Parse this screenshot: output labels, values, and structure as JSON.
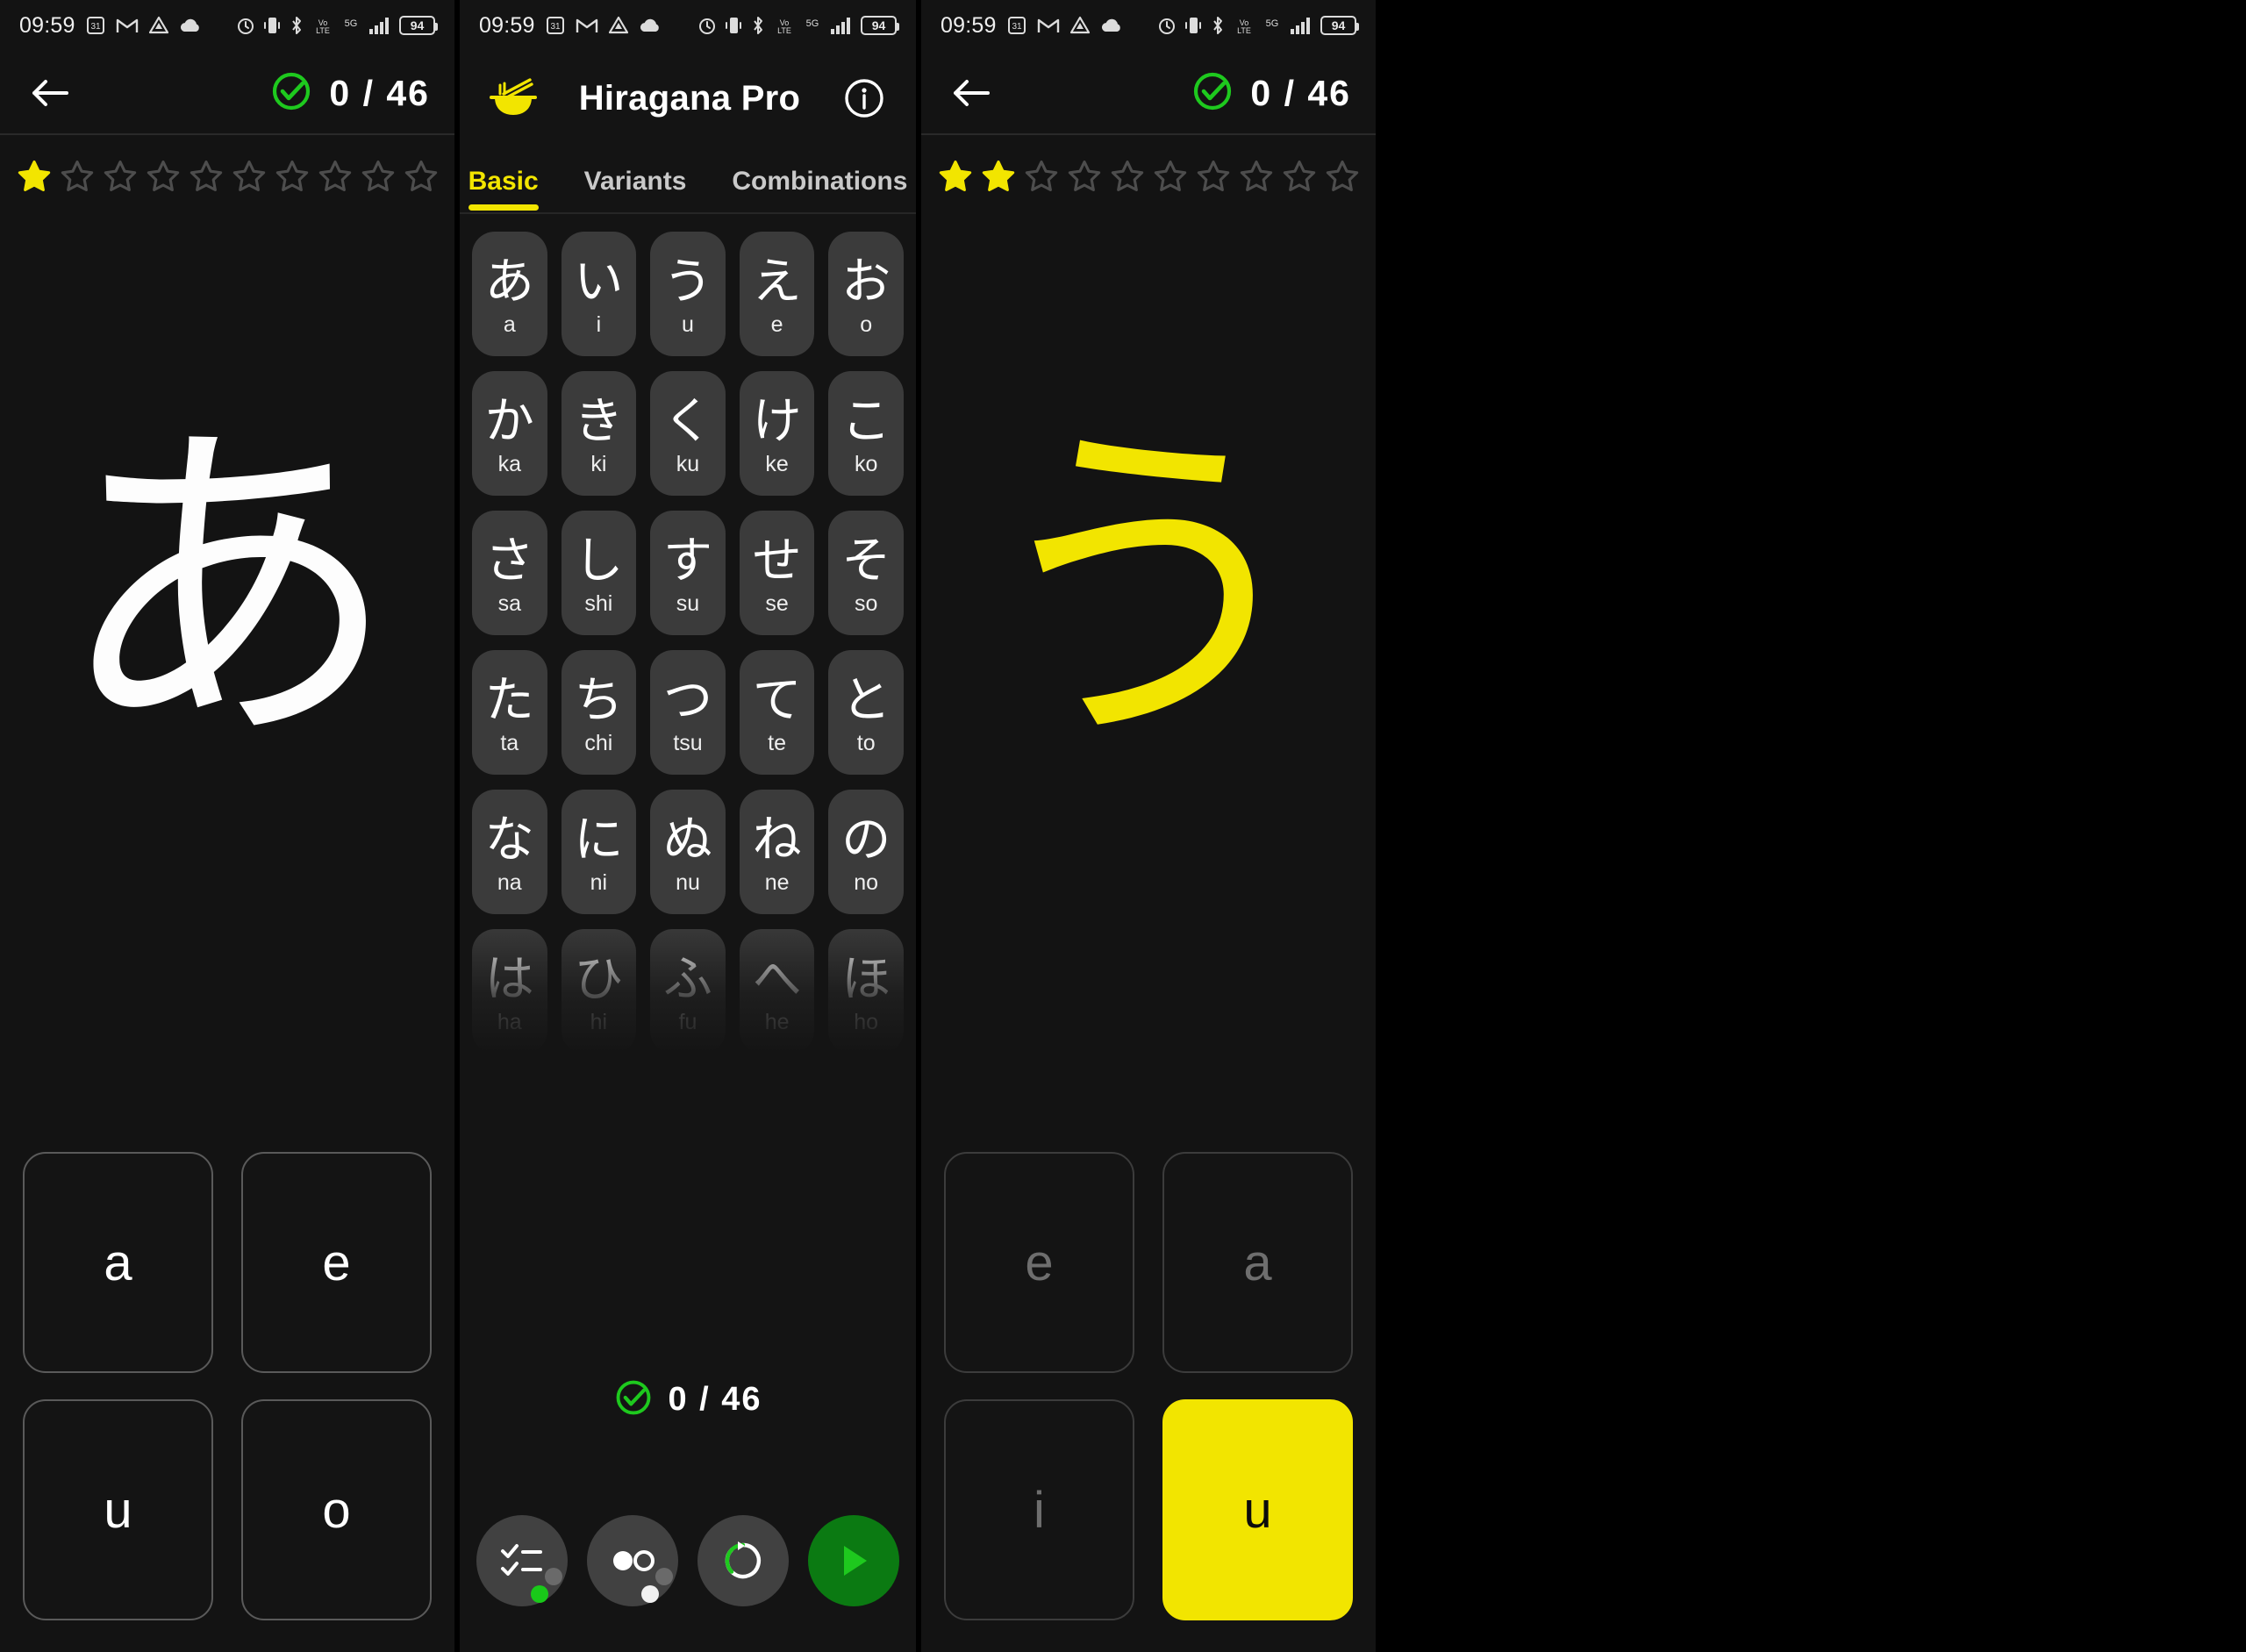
{
  "status_bar": {
    "time": "09:59",
    "left_icons": [
      "calendar-31-icon",
      "gmail-icon",
      "drive-icon",
      "cloud-icon"
    ],
    "right_icons": [
      "alarm-icon",
      "vibrate-icon",
      "bluetooth-icon",
      "volte-icon",
      "5g-icon",
      "signal-icon"
    ],
    "battery_level": "94"
  },
  "colors": {
    "accent_yellow": "#f2e500",
    "accent_green": "#19c919",
    "play_green": "#0b7a12",
    "background": "#131313",
    "tile": "#3b3b3b"
  },
  "quiz_left": {
    "back_icon": "back-arrow-icon",
    "check_icon": "check-circle-icon",
    "progress": "0 / 46",
    "stars_total": 10,
    "stars_filled": 1,
    "prompt_kana": "あ",
    "prompt_color": "white",
    "answers": [
      {
        "label": "a",
        "state": "default"
      },
      {
        "label": "e",
        "state": "default"
      },
      {
        "label": "u",
        "state": "default"
      },
      {
        "label": "o",
        "state": "default"
      }
    ]
  },
  "chart_app": {
    "logo_icon": "ramen-bowl-icon",
    "title": "Hiragana Pro",
    "info_icon": "info-icon",
    "tabs": [
      {
        "label": "Basic",
        "active": true
      },
      {
        "label": "Variants",
        "active": false
      },
      {
        "label": "Combinations",
        "active": false
      }
    ],
    "kana_rows": [
      [
        {
          "kana": "あ",
          "romaji": "a"
        },
        {
          "kana": "い",
          "romaji": "i"
        },
        {
          "kana": "う",
          "romaji": "u"
        },
        {
          "kana": "え",
          "romaji": "e"
        },
        {
          "kana": "お",
          "romaji": "o"
        }
      ],
      [
        {
          "kana": "か",
          "romaji": "ka"
        },
        {
          "kana": "き",
          "romaji": "ki"
        },
        {
          "kana": "く",
          "romaji": "ku"
        },
        {
          "kana": "け",
          "romaji": "ke"
        },
        {
          "kana": "こ",
          "romaji": "ko"
        }
      ],
      [
        {
          "kana": "さ",
          "romaji": "sa"
        },
        {
          "kana": "し",
          "romaji": "shi"
        },
        {
          "kana": "す",
          "romaji": "su"
        },
        {
          "kana": "せ",
          "romaji": "se"
        },
        {
          "kana": "そ",
          "romaji": "so"
        }
      ],
      [
        {
          "kana": "た",
          "romaji": "ta"
        },
        {
          "kana": "ち",
          "romaji": "chi"
        },
        {
          "kana": "つ",
          "romaji": "tsu"
        },
        {
          "kana": "て",
          "romaji": "te"
        },
        {
          "kana": "と",
          "romaji": "to"
        }
      ],
      [
        {
          "kana": "な",
          "romaji": "na"
        },
        {
          "kana": "に",
          "romaji": "ni"
        },
        {
          "kana": "ぬ",
          "romaji": "nu"
        },
        {
          "kana": "ね",
          "romaji": "ne"
        },
        {
          "kana": "の",
          "romaji": "no"
        }
      ],
      [
        {
          "kana": "は",
          "romaji": "ha"
        },
        {
          "kana": "ひ",
          "romaji": "hi"
        },
        {
          "kana": "ふ",
          "romaji": "fu"
        },
        {
          "kana": "へ",
          "romaji": "he"
        },
        {
          "kana": "ほ",
          "romaji": "ho"
        }
      ]
    ],
    "progress": "0 / 46",
    "check_icon": "check-circle-icon",
    "toolbar": [
      {
        "icon": "checklist-icon",
        "badges": [
          "gray",
          "green"
        ]
      },
      {
        "icon": "dakuten-circles-icon",
        "badges": [
          "gray",
          "white"
        ]
      },
      {
        "icon": "refresh-icon",
        "badges": []
      },
      {
        "icon": "play-icon",
        "badges": [],
        "style": "play"
      }
    ]
  },
  "quiz_right": {
    "back_icon": "back-arrow-icon",
    "check_icon": "check-circle-icon",
    "progress": "0 / 46",
    "stars_total": 10,
    "stars_filled": 2,
    "prompt_kana": "う",
    "prompt_color": "yellow",
    "answers": [
      {
        "label": "e",
        "state": "dim"
      },
      {
        "label": "a",
        "state": "dim"
      },
      {
        "label": "i",
        "state": "dim"
      },
      {
        "label": "u",
        "state": "correct"
      }
    ]
  }
}
